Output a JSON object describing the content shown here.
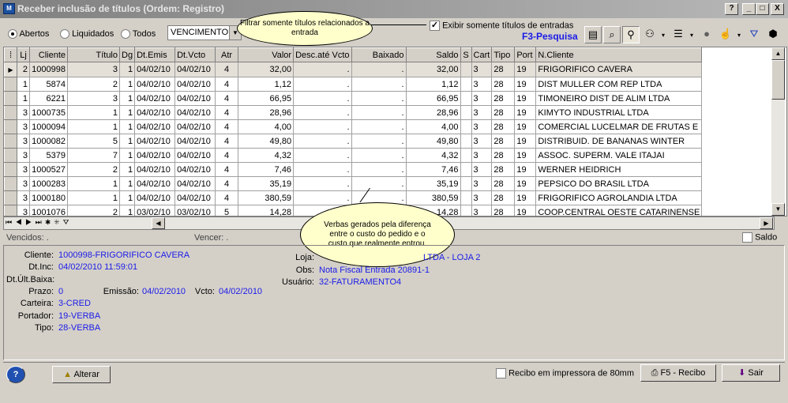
{
  "window": {
    "title": "Receber  inclusão de títulos (Ordem: Registro)",
    "controls": [
      "?",
      "_",
      "□",
      "X"
    ]
  },
  "toolbar": {
    "radios": [
      {
        "label": "Abertos",
        "checked": true
      },
      {
        "label": "Liquidados",
        "checked": false
      },
      {
        "label": "Todos",
        "checked": false
      }
    ],
    "order_select": "VENCIMENTO",
    "filter_checkbox_label": "Exibir somente títulos de entradas",
    "filter_checked": true,
    "search_hint": "F3-Pesquisa"
  },
  "callouts": {
    "filter_tip": "Filtrar somente títulos relacionados a entrada",
    "verbas_tip": "Verbas gerados pela diferença entre o custo do pedido e o custo que realmente entrou."
  },
  "grid": {
    "columns": [
      "Lj",
      "Cliente",
      "Título",
      "Dg",
      "Dt.Emis",
      "Dt.Vcto",
      "Atr",
      "Valor",
      "Desc.até Vcto",
      "Baixado",
      "Saldo",
      "S",
      "Cart",
      "Tipo",
      "Port",
      "N.Cliente"
    ],
    "rows": [
      [
        "2",
        "1000998",
        "3",
        "1",
        "04/02/10",
        "04/02/10",
        "4",
        "32,00",
        ".",
        ".",
        "32,00",
        "3",
        "28",
        "19",
        "",
        "FRIGORIFICO CAVERA"
      ],
      [
        "1",
        "5874",
        "2",
        "1",
        "04/02/10",
        "04/02/10",
        "4",
        "1,12",
        ".",
        ".",
        "1,12",
        "3",
        "28",
        "19",
        "",
        "DIST MULLER COM REP LTDA"
      ],
      [
        "1",
        "6221",
        "3",
        "1",
        "04/02/10",
        "04/02/10",
        "4",
        "66,95",
        ".",
        ".",
        "66,95",
        "3",
        "28",
        "19",
        "",
        "TIMONEIRO DIST DE ALIM LTDA"
      ],
      [
        "3",
        "1000735",
        "1",
        "1",
        "04/02/10",
        "04/02/10",
        "4",
        "28,96",
        ".",
        ".",
        "28,96",
        "3",
        "28",
        "19",
        "",
        "KIMYTO INDUSTRIAL LTDA"
      ],
      [
        "3",
        "1000094",
        "1",
        "1",
        "04/02/10",
        "04/02/10",
        "4",
        "4,00",
        ".",
        ".",
        "4,00",
        "3",
        "28",
        "19",
        "",
        "COMERCIAL LUCELMAR DE FRUTAS E"
      ],
      [
        "3",
        "1000082",
        "5",
        "1",
        "04/02/10",
        "04/02/10",
        "4",
        "49,80",
        ".",
        ".",
        "49,80",
        "3",
        "28",
        "19",
        "",
        "DISTRIBUID. DE BANANAS WINTER"
      ],
      [
        "3",
        "5379",
        "7",
        "1",
        "04/02/10",
        "04/02/10",
        "4",
        "4,32",
        ".",
        ".",
        "4,32",
        "3",
        "28",
        "19",
        "",
        "ASSOC. SUPERM. VALE ITAJAI"
      ],
      [
        "3",
        "1000527",
        "2",
        "1",
        "04/02/10",
        "04/02/10",
        "4",
        "7,46",
        ".",
        ".",
        "7,46",
        "3",
        "28",
        "19",
        "",
        "WERNER HEIDRICH"
      ],
      [
        "3",
        "1000283",
        "1",
        "1",
        "04/02/10",
        "04/02/10",
        "4",
        "35,19",
        ".",
        ".",
        "35,19",
        "3",
        "28",
        "19",
        "",
        "PEPSICO DO BRASIL LTDA"
      ],
      [
        "3",
        "1000180",
        "1",
        "1",
        "04/02/10",
        "04/02/10",
        "4",
        "380,59",
        ".",
        ".",
        "380,59",
        "3",
        "28",
        "19",
        "",
        "FRIGORIFICO AGROLANDIA LTDA"
      ],
      [
        "3",
        "1001076",
        "2",
        "1",
        "03/02/10",
        "03/02/10",
        "5",
        "14,28",
        "",
        "",
        "14,28",
        "3",
        "28",
        "19",
        "",
        "COOP.CENTRAL OESTE CATARINENSE"
      ]
    ]
  },
  "status": {
    "vencidos": "Vencidos:",
    "vencer": "Vencer:",
    "saldo_label": "Saldo"
  },
  "details": {
    "cliente_k": "Cliente:",
    "cliente_v": "1000998-FRIGORIFICO CAVERA",
    "dtinc_k": "Dt.Inc:",
    "dtinc_v": "04/02/2010 11:59:01",
    "dtultbaixa_k": "Dt.Últ.Baixa:",
    "prazo_k": "Prazo:",
    "prazo_v": "0",
    "emissao_k": "Emissão:",
    "emissao_v": "04/02/2010",
    "vcto_k": "Vcto:",
    "vcto_v": "04/02/2010",
    "carteira_k": "Carteira:",
    "carteira_v": "3-CRED",
    "portador_k": "Portador:",
    "portador_v": "19-VERBA",
    "tipo_k": "Tipo:",
    "tipo_v": "28-VERBA",
    "loja_k": "Loja:",
    "loja_v": "LTDA - LOJA 2",
    "obs_k": "Obs:",
    "obs_v": "Nota Fiscal Entrada 20891-1",
    "usuario_k": "Usuário:",
    "usuario_v": "32-FATURAMENTO4"
  },
  "footer": {
    "help": "?",
    "alterar": "Alterar",
    "recibo_80": "Recibo em impressora de 80mm",
    "recibo_btn": "F5 - Recibo",
    "sair": "Sair"
  }
}
